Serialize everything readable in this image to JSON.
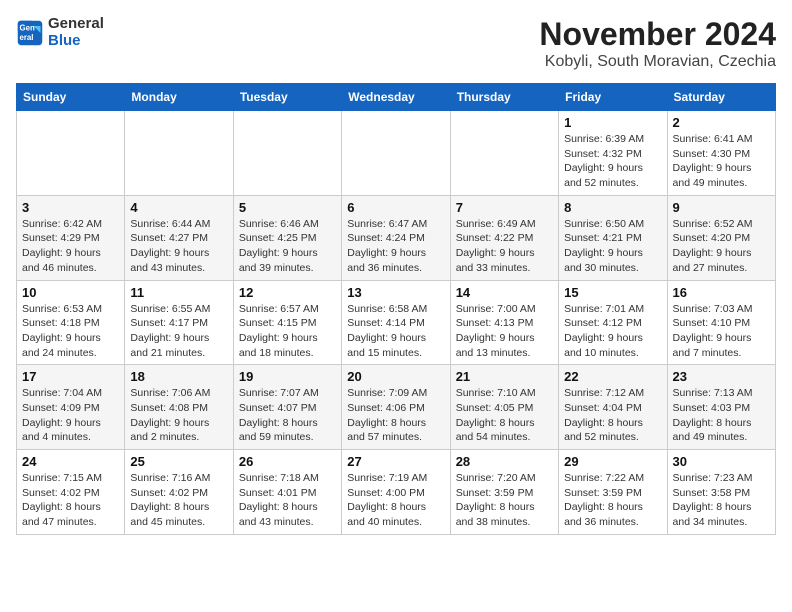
{
  "header": {
    "logo_line1": "General",
    "logo_line2": "Blue",
    "month": "November 2024",
    "location": "Kobyli, South Moravian, Czechia"
  },
  "weekdays": [
    "Sunday",
    "Monday",
    "Tuesday",
    "Wednesday",
    "Thursday",
    "Friday",
    "Saturday"
  ],
  "weeks": [
    [
      {
        "day": "",
        "info": ""
      },
      {
        "day": "",
        "info": ""
      },
      {
        "day": "",
        "info": ""
      },
      {
        "day": "",
        "info": ""
      },
      {
        "day": "",
        "info": ""
      },
      {
        "day": "1",
        "info": "Sunrise: 6:39 AM\nSunset: 4:32 PM\nDaylight: 9 hours\nand 52 minutes."
      },
      {
        "day": "2",
        "info": "Sunrise: 6:41 AM\nSunset: 4:30 PM\nDaylight: 9 hours\nand 49 minutes."
      }
    ],
    [
      {
        "day": "3",
        "info": "Sunrise: 6:42 AM\nSunset: 4:29 PM\nDaylight: 9 hours\nand 46 minutes."
      },
      {
        "day": "4",
        "info": "Sunrise: 6:44 AM\nSunset: 4:27 PM\nDaylight: 9 hours\nand 43 minutes."
      },
      {
        "day": "5",
        "info": "Sunrise: 6:46 AM\nSunset: 4:25 PM\nDaylight: 9 hours\nand 39 minutes."
      },
      {
        "day": "6",
        "info": "Sunrise: 6:47 AM\nSunset: 4:24 PM\nDaylight: 9 hours\nand 36 minutes."
      },
      {
        "day": "7",
        "info": "Sunrise: 6:49 AM\nSunset: 4:22 PM\nDaylight: 9 hours\nand 33 minutes."
      },
      {
        "day": "8",
        "info": "Sunrise: 6:50 AM\nSunset: 4:21 PM\nDaylight: 9 hours\nand 30 minutes."
      },
      {
        "day": "9",
        "info": "Sunrise: 6:52 AM\nSunset: 4:20 PM\nDaylight: 9 hours\nand 27 minutes."
      }
    ],
    [
      {
        "day": "10",
        "info": "Sunrise: 6:53 AM\nSunset: 4:18 PM\nDaylight: 9 hours\nand 24 minutes."
      },
      {
        "day": "11",
        "info": "Sunrise: 6:55 AM\nSunset: 4:17 PM\nDaylight: 9 hours\nand 21 minutes."
      },
      {
        "day": "12",
        "info": "Sunrise: 6:57 AM\nSunset: 4:15 PM\nDaylight: 9 hours\nand 18 minutes."
      },
      {
        "day": "13",
        "info": "Sunrise: 6:58 AM\nSunset: 4:14 PM\nDaylight: 9 hours\nand 15 minutes."
      },
      {
        "day": "14",
        "info": "Sunrise: 7:00 AM\nSunset: 4:13 PM\nDaylight: 9 hours\nand 13 minutes."
      },
      {
        "day": "15",
        "info": "Sunrise: 7:01 AM\nSunset: 4:12 PM\nDaylight: 9 hours\nand 10 minutes."
      },
      {
        "day": "16",
        "info": "Sunrise: 7:03 AM\nSunset: 4:10 PM\nDaylight: 9 hours\nand 7 minutes."
      }
    ],
    [
      {
        "day": "17",
        "info": "Sunrise: 7:04 AM\nSunset: 4:09 PM\nDaylight: 9 hours\nand 4 minutes."
      },
      {
        "day": "18",
        "info": "Sunrise: 7:06 AM\nSunset: 4:08 PM\nDaylight: 9 hours\nand 2 minutes."
      },
      {
        "day": "19",
        "info": "Sunrise: 7:07 AM\nSunset: 4:07 PM\nDaylight: 8 hours\nand 59 minutes."
      },
      {
        "day": "20",
        "info": "Sunrise: 7:09 AM\nSunset: 4:06 PM\nDaylight: 8 hours\nand 57 minutes."
      },
      {
        "day": "21",
        "info": "Sunrise: 7:10 AM\nSunset: 4:05 PM\nDaylight: 8 hours\nand 54 minutes."
      },
      {
        "day": "22",
        "info": "Sunrise: 7:12 AM\nSunset: 4:04 PM\nDaylight: 8 hours\nand 52 minutes."
      },
      {
        "day": "23",
        "info": "Sunrise: 7:13 AM\nSunset: 4:03 PM\nDaylight: 8 hours\nand 49 minutes."
      }
    ],
    [
      {
        "day": "24",
        "info": "Sunrise: 7:15 AM\nSunset: 4:02 PM\nDaylight: 8 hours\nand 47 minutes."
      },
      {
        "day": "25",
        "info": "Sunrise: 7:16 AM\nSunset: 4:02 PM\nDaylight: 8 hours\nand 45 minutes."
      },
      {
        "day": "26",
        "info": "Sunrise: 7:18 AM\nSunset: 4:01 PM\nDaylight: 8 hours\nand 43 minutes."
      },
      {
        "day": "27",
        "info": "Sunrise: 7:19 AM\nSunset: 4:00 PM\nDaylight: 8 hours\nand 40 minutes."
      },
      {
        "day": "28",
        "info": "Sunrise: 7:20 AM\nSunset: 3:59 PM\nDaylight: 8 hours\nand 38 minutes."
      },
      {
        "day": "29",
        "info": "Sunrise: 7:22 AM\nSunset: 3:59 PM\nDaylight: 8 hours\nand 36 minutes."
      },
      {
        "day": "30",
        "info": "Sunrise: 7:23 AM\nSunset: 3:58 PM\nDaylight: 8 hours\nand 34 minutes."
      }
    ]
  ]
}
